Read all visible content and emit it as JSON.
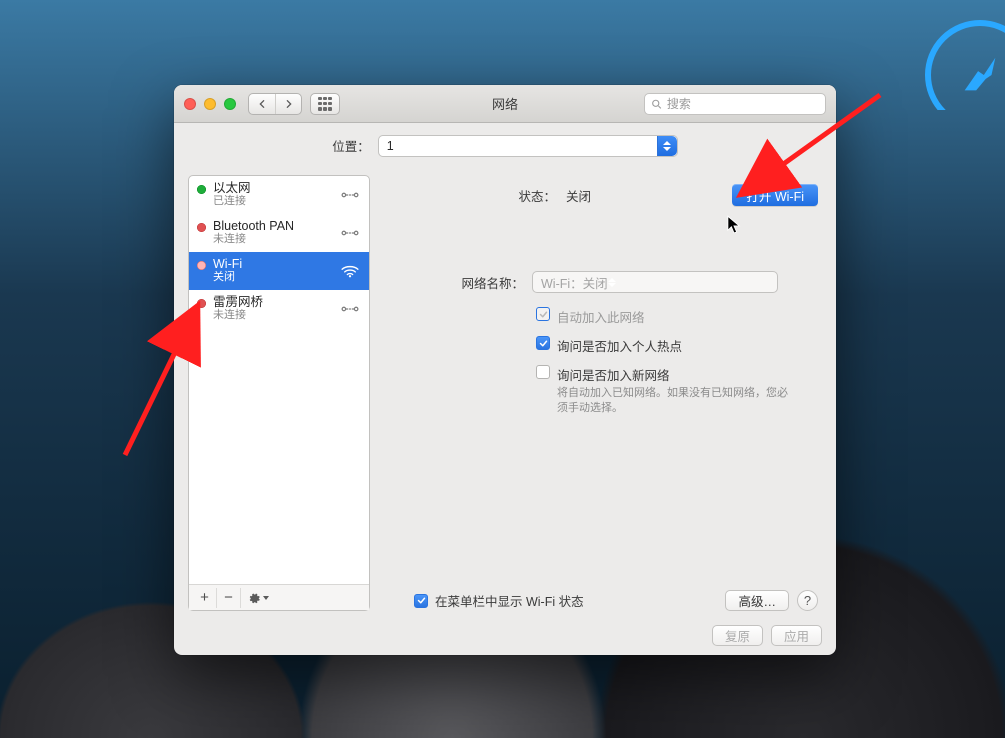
{
  "window": {
    "title": "网络"
  },
  "toolbar": {
    "back_icon": "chevron-left",
    "forward_icon": "chevron-right",
    "apps_icon": "grid",
    "search_placeholder": "搜索"
  },
  "location": {
    "label": "位置：",
    "selected": "1"
  },
  "sidebar": {
    "items": [
      {
        "name": "以太网",
        "status": "已连接",
        "dot": "green",
        "icon": "ethernet",
        "selected": false
      },
      {
        "name": "Bluetooth PAN",
        "status": "未连接",
        "dot": "red",
        "icon": "ethernet",
        "selected": false
      },
      {
        "name": "Wi-Fi",
        "status": "关闭",
        "dot": "red",
        "icon": "wifi",
        "selected": true
      },
      {
        "name": "雷雳网桥",
        "status": "未连接",
        "dot": "red",
        "icon": "ethernet",
        "selected": false
      }
    ],
    "footer": {
      "plus": "+",
      "minus": "−",
      "settings_icon": "gear"
    }
  },
  "panel": {
    "status_label": "状态：",
    "status_value": "关闭",
    "toggle_button": "打开 Wi-Fi",
    "network_name_label": "网络名称：",
    "network_name_value": "Wi-Fi：关闭",
    "checkboxes": {
      "auto_join": {
        "label": "自动加入此网络",
        "checked": true,
        "disabled": true
      },
      "ask_personal_hotspot": {
        "label": "询问是否加入个人热点",
        "checked": true,
        "disabled": false
      },
      "ask_new_networks": {
        "label": "询问是否加入新网络",
        "sub": "将自动加入已知网络。如果没有已知网络，您必须手动选择。",
        "checked": false,
        "disabled": false
      }
    },
    "show_in_menubar": {
      "label": "在菜单栏中显示 Wi-Fi 状态",
      "checked": true
    },
    "advanced_button": "高级…",
    "help_button": "?",
    "revert_button": "复原",
    "apply_button": "应用"
  }
}
